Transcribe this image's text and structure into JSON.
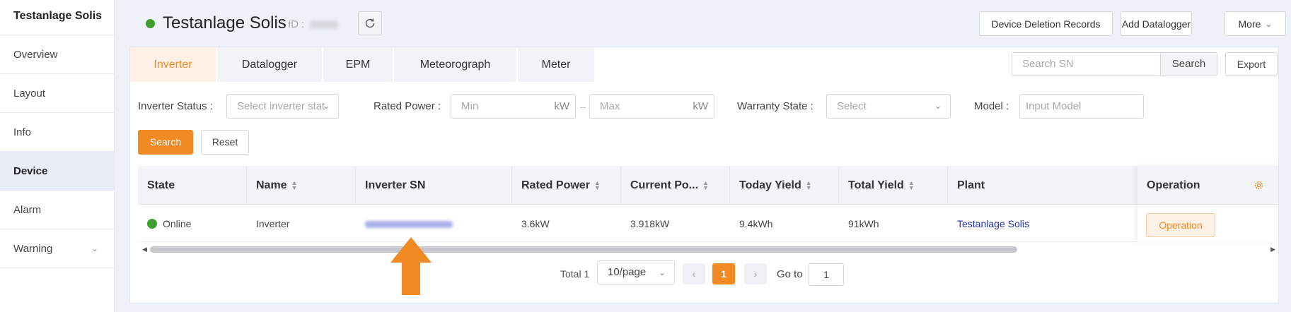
{
  "sidebar": {
    "title": "Testanlage Solis",
    "items": [
      {
        "label": "Overview"
      },
      {
        "label": "Layout"
      },
      {
        "label": "Info"
      },
      {
        "label": "Device"
      },
      {
        "label": "Alarm"
      },
      {
        "label": "Warning"
      }
    ]
  },
  "header": {
    "title": "Testanlage Solis",
    "id_label": "ID :",
    "status_color": "#3f9d2b",
    "buttons": {
      "deletion": "Device Deletion Records",
      "add_logger": "Add Datalogger",
      "more": "More"
    }
  },
  "tabs": [
    {
      "label": "Inverter",
      "active": true
    },
    {
      "label": "Datalogger"
    },
    {
      "label": "EPM"
    },
    {
      "label": "Meteorograph"
    },
    {
      "label": "Meter"
    }
  ],
  "search": {
    "placeholder": "Search SN",
    "button": "Search",
    "export": "Export"
  },
  "filters": {
    "status_label": "Inverter Status :",
    "status_placeholder": "Select inverter stat",
    "power_label": "Rated Power :",
    "power_min": "Min",
    "power_max": "Max",
    "power_unit": "kW",
    "warranty_label": "Warranty State :",
    "warranty_placeholder": "Select",
    "model_label": "Model :",
    "model_placeholder": "Input Model",
    "search_btn": "Search",
    "reset_btn": "Reset"
  },
  "table": {
    "columns": [
      "State",
      "Name",
      "Inverter SN",
      "Rated Power",
      "Current Po...",
      "Today Yield",
      "Total Yield",
      "Plant",
      "Operation"
    ],
    "rows": [
      {
        "state": "Online",
        "name": "Inverter",
        "rated_power": "3.6kW",
        "current_power": "3.918kW",
        "today_yield": "9.4kWh",
        "total_yield": "91kWh",
        "plant": "Testanlage Solis",
        "operation": "Operation"
      }
    ]
  },
  "pagination": {
    "total": "Total 1",
    "page_size": "10/page",
    "current": "1",
    "goto_label": "Go to",
    "goto_value": "1"
  },
  "colors": {
    "accent": "#f28a24",
    "online": "#3f9d2b",
    "link": "#1f2fa8"
  }
}
